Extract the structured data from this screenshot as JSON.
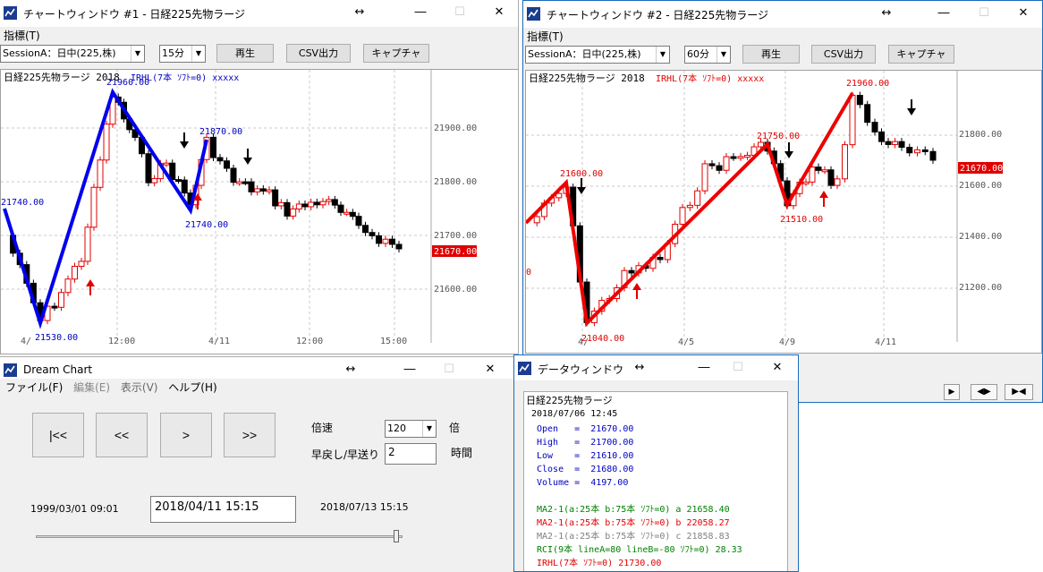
{
  "chart1": {
    "title": "チャートウィンドウ #1 - 日経225先物ラージ",
    "menu": "指標(T)",
    "session": "SessionA：日中(225,株)",
    "interval": "15分",
    "btn_replay": "再生",
    "btn_csv": "CSV出力",
    "btn_capture": "キャプチャ",
    "chart_title": "日経225先物ラージ 2018",
    "indicator": "IRHL(7本 ｿﾌﾄ=0) xxxxx",
    "price_labels": [
      "21900.00",
      "21800.00",
      "21700.00",
      "21600.00"
    ],
    "current": "21670.00",
    "x_labels": [
      "4/",
      "12:00",
      "4/11",
      "12:00",
      "15:00"
    ],
    "zz_labels": [
      "21740.00",
      "21530.00",
      "21960.00",
      "21870.00",
      "21740.00"
    ]
  },
  "chart2": {
    "title": "チャートウィンドウ #2 - 日経225先物ラージ",
    "menu": "指標(T)",
    "session": "SessionA：日中(225,株)",
    "interval": "60分",
    "btn_replay": "再生",
    "btn_csv": "CSV出力",
    "btn_capture": "キャプチャ",
    "chart_title": "日経225先物ラージ 2018",
    "indicator": "IRHL(7本 ｿﾌﾄ=0) xxxxx",
    "price_labels": [
      "21800.00",
      "21600.00",
      "21400.00",
      "21200.00"
    ],
    "current": "21670.00",
    "x_labels": [
      "4/",
      "4/5",
      "4/9",
      "4/11"
    ],
    "zz_labels": [
      "21600.00",
      "21040.00",
      "21750.00",
      "21510.00",
      "21960.00"
    ],
    "edge_label": "0"
  },
  "dream": {
    "title": "Dream Chart",
    "menu": [
      "ファイル(F)",
      "編集(E)",
      "表示(V)",
      "ヘルプ(H)"
    ],
    "buttons": [
      "|<<",
      "<<",
      ">",
      ">>"
    ],
    "speed_label": "倍速",
    "speed_value": "120",
    "speed_unit": "倍",
    "rewind_label": "早戻し/早送り",
    "rewind_value": "2",
    "rewind_unit": "時間",
    "start_date": "1999/03/01 09:01",
    "current_date": "2018/04/11 15:15",
    "end_date": "2018/07/13 15:15",
    "slider_value": 0.99
  },
  "datawin": {
    "title": "データウィンドウ",
    "name": "日経225先物ラージ",
    "datetime": "2018/07/06 12:45",
    "ohlcv": [
      {
        "label": "Open",
        "value": "21670.00"
      },
      {
        "label": "High",
        "value": "21700.00"
      },
      {
        "label": "Low",
        "value": "21610.00"
      },
      {
        "label": "Close",
        "value": "21680.00"
      },
      {
        "label": "Volume",
        "value": "4197.00"
      }
    ],
    "indicators": [
      {
        "text": "MA2-1(a:25本 b:75本 ｿﾌﾄ=0) a 21658.40",
        "color": "#008000"
      },
      {
        "text": "MA2-1(a:25本 b:75本 ｿﾌﾄ=0) b 22058.27",
        "color": "#e00000"
      },
      {
        "text": "MA2-1(a:25本 b:75本 ｿﾌﾄ=0) c 21858.83",
        "color": "#808080"
      },
      {
        "text": "RCI(9本 lineA=80 lineB=-80 ｿﾌﾄ=0) 28.33",
        "color": "#008000"
      },
      {
        "text": "IRHL(7本 ｿﾌﾄ=0) 21730.00",
        "color": "#e00000"
      }
    ]
  },
  "colors": {
    "up": "#e00000",
    "down": "#000000",
    "zz1": "#0000ee",
    "zz2": "#ee0000",
    "accent": "#0000c0"
  }
}
